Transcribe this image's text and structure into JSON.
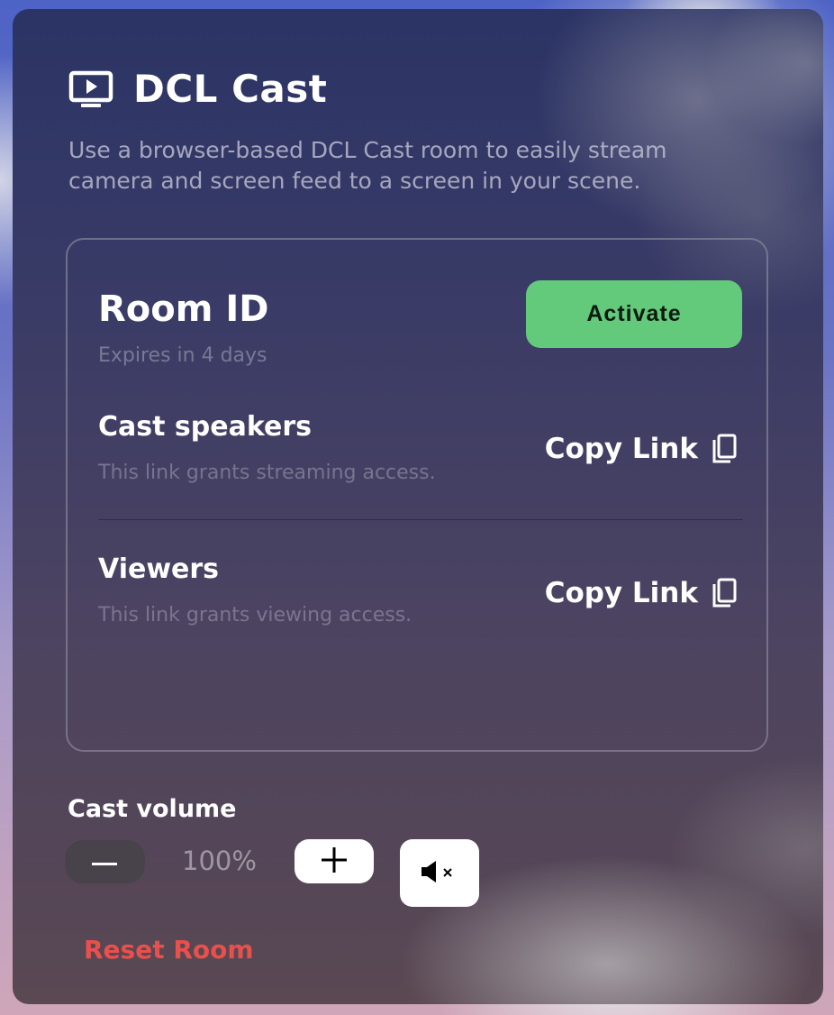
{
  "header": {
    "title": "DCL Cast",
    "icon": "screen-play-icon",
    "description": "Use a browser-based DCL Cast room to easily stream camera and screen feed to a screen in your scene."
  },
  "room": {
    "title": "Room ID",
    "expires": "Expires in 4 days",
    "activate_label": "Activate"
  },
  "links": [
    {
      "title": "Cast speakers",
      "subtitle": "This link grants streaming access.",
      "copy_label": "Copy Link",
      "icon": "copy-icon"
    },
    {
      "title": "Viewers",
      "subtitle": "This link grants viewing access.",
      "copy_label": "Copy Link",
      "icon": "copy-icon"
    }
  ],
  "volume": {
    "label": "Cast volume",
    "value": "100%",
    "decrease_icon": "minus-icon",
    "increase_icon": "plus-icon",
    "mute_icon": "speaker-muted-icon"
  },
  "reset_label": "Reset Room",
  "colors": {
    "accent_green": "#63c97b",
    "danger_red": "#e8504c",
    "text_primary": "#ffffff"
  }
}
